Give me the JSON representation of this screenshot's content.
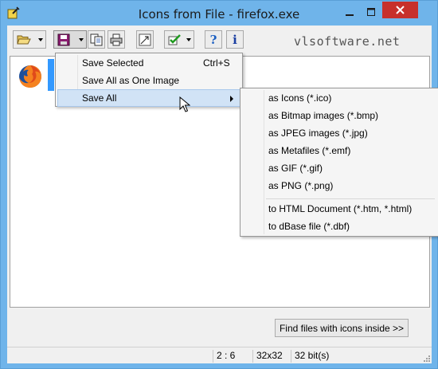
{
  "window": {
    "title": "Icons from File - firefox.exe",
    "close_color": "#c7302b",
    "frame_color": "#6fb4ea"
  },
  "toolbar": {
    "open_icon": "folder-open-icon",
    "save_icon": "floppy-disk-icon",
    "copy_icon": "copy-icon",
    "print_icon": "printer-icon",
    "resize_icon": "resize-icon",
    "check_icon": "checkmark-icon",
    "help_label": "?",
    "info_label": "i",
    "brand": "vlsoftware.net"
  },
  "save_menu": {
    "items": [
      {
        "label": "Save Selected",
        "shortcut": "Ctrl+S"
      },
      {
        "label": "Save All as One Image",
        "shortcut": ""
      },
      {
        "label": "Save All",
        "shortcut": ""
      }
    ]
  },
  "save_all_submenu": {
    "items": [
      {
        "label": "as Icons (*.ico)"
      },
      {
        "label": "as Bitmap images (*.bmp)"
      },
      {
        "label": "as JPEG images (*.jpg)"
      },
      {
        "label": "as Metafiles (*.emf)"
      },
      {
        "label": "as GIF (*.gif)"
      },
      {
        "label": "as PNG (*.png)"
      },
      {
        "label": "to HTML Document (*.htm, *.html)"
      },
      {
        "label": "to dBase file (*.dbf)"
      }
    ]
  },
  "find_button": {
    "label": "Find files with icons inside >>"
  },
  "status": {
    "position": "2 : 6",
    "size": "32x32",
    "depth": "32 bit(s)"
  },
  "selection_color": "#3399ff"
}
